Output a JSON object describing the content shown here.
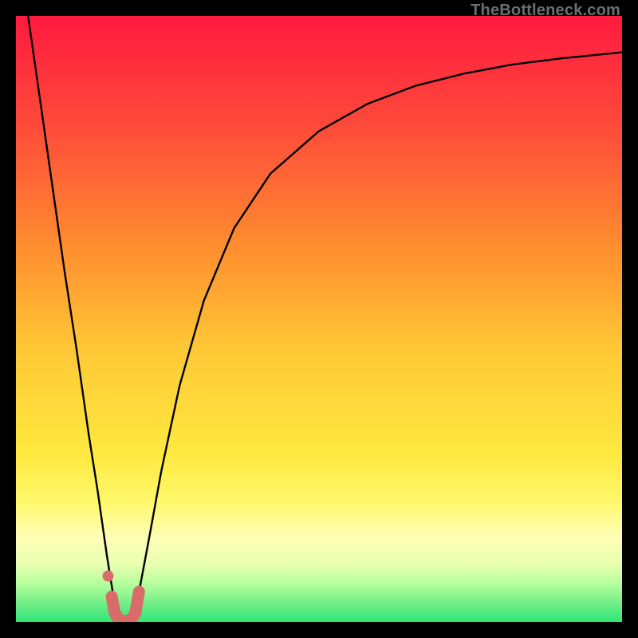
{
  "watermark": "TheBottleneck.com",
  "chart_data": {
    "type": "line",
    "title": "",
    "xlabel": "",
    "ylabel": "",
    "xlim": [
      0,
      100
    ],
    "ylim": [
      0,
      100
    ],
    "grid": false,
    "legend": false,
    "background_gradient_stops": [
      {
        "offset": 0.0,
        "color": "#ff1a3f"
      },
      {
        "offset": 0.18,
        "color": "#ff4a3a"
      },
      {
        "offset": 0.38,
        "color": "#ff8d2f"
      },
      {
        "offset": 0.55,
        "color": "#ffc836"
      },
      {
        "offset": 0.72,
        "color": "#ffe83f"
      },
      {
        "offset": 0.8,
        "color": "#fff86a"
      },
      {
        "offset": 0.86,
        "color": "#ffffb5"
      },
      {
        "offset": 0.905,
        "color": "#e8ffb0"
      },
      {
        "offset": 0.935,
        "color": "#b9ff9e"
      },
      {
        "offset": 0.965,
        "color": "#7cf08a"
      },
      {
        "offset": 1.0,
        "color": "#2fe57a"
      }
    ],
    "series": [
      {
        "name": "left-branch",
        "stroke": "#000000",
        "width": 2.4,
        "x": [
          2.0,
          5.0,
          8.0,
          10.0,
          12.0,
          13.5,
          15.0,
          16.2,
          17.0
        ],
        "y": [
          100.0,
          79.0,
          58.0,
          45.0,
          31.0,
          21.5,
          11.0,
          3.5,
          0.5
        ]
      },
      {
        "name": "right-branch",
        "stroke": "#000000",
        "width": 2.4,
        "x": [
          19.0,
          20.5,
          22.0,
          24.0,
          27.0,
          31.0,
          36.0,
          42.0,
          50.0,
          58.0,
          66.0,
          74.0,
          82.0,
          90.0,
          100.0
        ],
        "y": [
          0.5,
          6.0,
          14.0,
          25.0,
          39.0,
          53.0,
          65.0,
          74.0,
          81.0,
          85.5,
          88.5,
          90.5,
          92.0,
          93.0,
          94.0
        ]
      },
      {
        "name": "marker-arc",
        "stroke": "#d96b6b",
        "width": 15,
        "linecap": "round",
        "x": [
          15.8,
          16.3,
          17.0,
          18.0,
          19.0,
          19.7,
          20.3
        ],
        "y": [
          4.2,
          1.5,
          0.4,
          0.1,
          0.4,
          1.5,
          5.0
        ]
      }
    ],
    "points": [
      {
        "name": "marker-dot-upper",
        "x": 15.2,
        "y": 7.6,
        "r": 7,
        "fill": "#d96b6b"
      },
      {
        "name": "marker-dot-lower",
        "x": 15.8,
        "y": 4.2,
        "r": 7,
        "fill": "#d96b6b"
      }
    ]
  }
}
